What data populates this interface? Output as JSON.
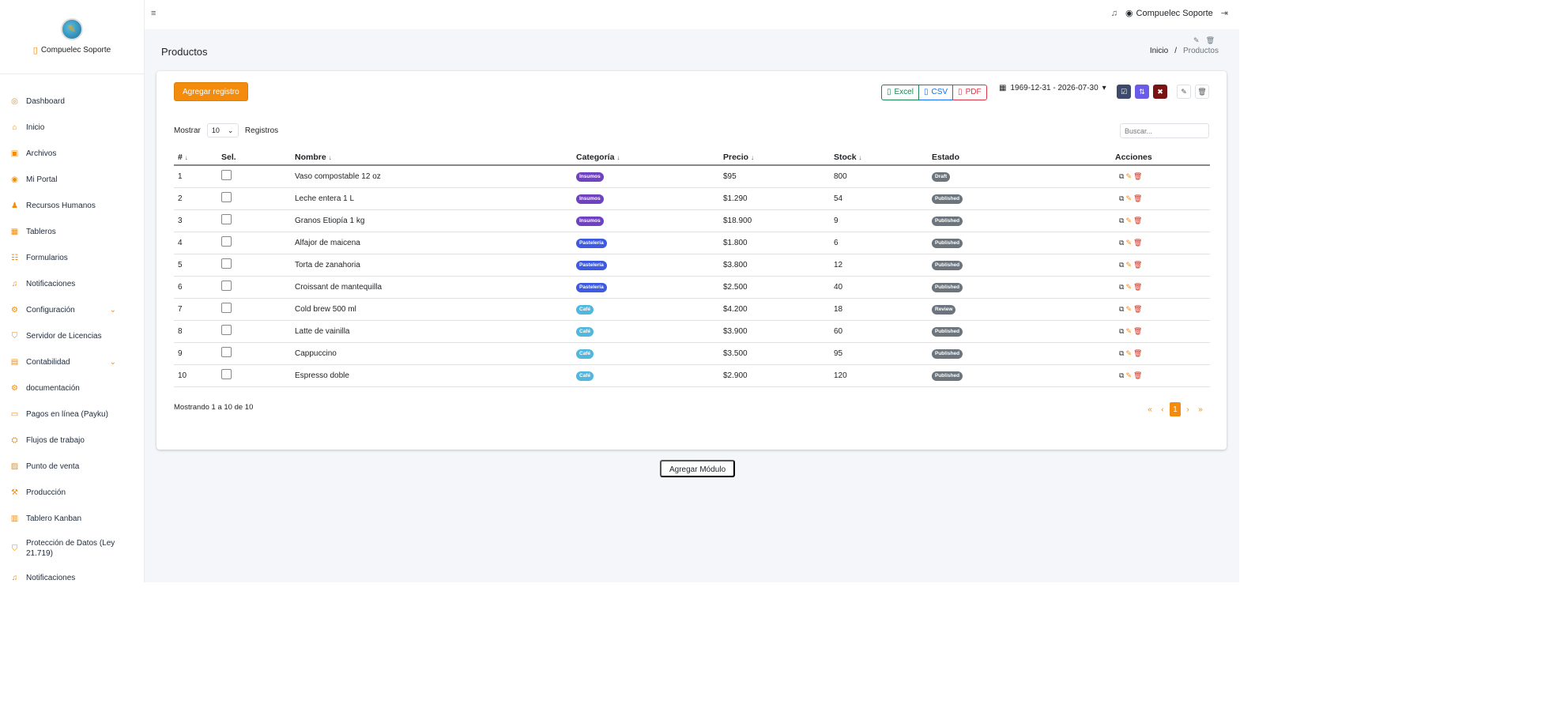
{
  "brand": {
    "name": "Compuelec Soporte"
  },
  "sidebar": {
    "items": [
      {
        "label": "Dashboard",
        "icon": "dashboard-icon",
        "glyph": "◎"
      },
      {
        "label": "Inicio",
        "icon": "home-icon",
        "glyph": "⌂"
      },
      {
        "label": "Archivos",
        "icon": "file-icon",
        "glyph": "▣"
      },
      {
        "label": "Mi Portal",
        "icon": "user-circle-icon",
        "glyph": "◉"
      },
      {
        "label": "Recursos Humanos",
        "icon": "users-icon",
        "glyph": "♟"
      },
      {
        "label": "Tableros",
        "icon": "grid-icon",
        "glyph": "▦"
      },
      {
        "label": "Formularios",
        "icon": "form-icon",
        "glyph": "☷"
      },
      {
        "label": "Notificaciones",
        "icon": "bell-icon",
        "glyph": "♫"
      },
      {
        "label": "Configuración",
        "icon": "gear-icon",
        "glyph": "⚙",
        "chevron": true
      },
      {
        "label": "Servidor de Licencias",
        "icon": "shield-icon",
        "glyph": "⛉"
      },
      {
        "label": "Contabilidad",
        "icon": "calculator-icon",
        "glyph": "▤",
        "chevron": true
      },
      {
        "label": "documentación",
        "icon": "gear-icon",
        "glyph": "⚙"
      },
      {
        "label": "Pagos en línea (Payku)",
        "icon": "card-icon",
        "glyph": "▭"
      },
      {
        "label": "Flujos de trabajo",
        "icon": "flow-icon",
        "glyph": "⛭"
      },
      {
        "label": "Punto de venta",
        "icon": "pos-icon",
        "glyph": "▨"
      },
      {
        "label": "Producción",
        "icon": "hammer-icon",
        "glyph": "⚒"
      },
      {
        "label": "Tablero Kanban",
        "icon": "kanban-icon",
        "glyph": "▥"
      },
      {
        "label": "Protección de Datos (Ley 21.719)",
        "icon": "shield-icon",
        "glyph": "⛉",
        "twoLine": true
      },
      {
        "label": "Notificaciones",
        "icon": "bell-icon",
        "glyph": "♫"
      }
    ]
  },
  "header": {
    "menu_glyph": "≡",
    "user_name": "Compuelec Soporte"
  },
  "page": {
    "title": "Productos",
    "breadcrumb": [
      "Inicio",
      "/",
      "Productos"
    ]
  },
  "toolbar": {
    "add_label": "Agregar registro",
    "excel_label": "Excel",
    "csv_label": "CSV",
    "pdf_label": "PDF",
    "date_range": "1969-12-31 - 2026-07-30"
  },
  "table_controls": {
    "show_label": "Mostrar",
    "page_size": "10",
    "records_label": "Registros",
    "search_placeholder": "Buscar..."
  },
  "table": {
    "headers": [
      "#",
      "Sel.",
      "Nombre",
      "Categoría",
      "Precio",
      "Stock",
      "Estado",
      "Acciones"
    ],
    "rows": [
      {
        "n": "1",
        "name": "Vaso compostable 12 oz",
        "cat": "Insumos",
        "price": "$95",
        "stock": "800",
        "status": "Draft"
      },
      {
        "n": "2",
        "name": "Leche entera 1 L",
        "cat": "Insumos",
        "price": "$1.290",
        "stock": "54",
        "status": "Published"
      },
      {
        "n": "3",
        "name": "Granos Etiopía 1 kg",
        "cat": "Insumos",
        "price": "$18.900",
        "stock": "9",
        "status": "Published"
      },
      {
        "n": "4",
        "name": "Alfajor de maicena",
        "cat": "Pastelería",
        "price": "$1.800",
        "stock": "6",
        "status": "Published"
      },
      {
        "n": "5",
        "name": "Torta de zanahoria",
        "cat": "Pastelería",
        "price": "$3.800",
        "stock": "12",
        "status": "Published"
      },
      {
        "n": "6",
        "name": "Croissant de mantequilla",
        "cat": "Pastelería",
        "price": "$2.500",
        "stock": "40",
        "status": "Published"
      },
      {
        "n": "7",
        "name": "Cold brew 500 ml",
        "cat": "Café",
        "price": "$4.200",
        "stock": "18",
        "status": "Review"
      },
      {
        "n": "8",
        "name": "Latte de vainilla",
        "cat": "Café",
        "price": "$3.900",
        "stock": "60",
        "status": "Published"
      },
      {
        "n": "9",
        "name": "Cappuccino",
        "cat": "Café",
        "price": "$3.500",
        "stock": "95",
        "status": "Published"
      },
      {
        "n": "10",
        "name": "Espresso doble",
        "cat": "Café",
        "price": "$2.900",
        "stock": "120",
        "status": "Published"
      }
    ]
  },
  "badge_colors": {
    "Insumos": "#6f42c1",
    "Pastelería": "#3d5ae0",
    "Café": "#4fb7e0",
    "Draft": "#6c757d",
    "Published": "#6c757d",
    "Review": "#6c757d"
  },
  "footer": {
    "info": "Mostrando 1 a 10 de 10",
    "pager": [
      "«",
      "‹",
      "1",
      "›",
      "»"
    ],
    "current_page": "1"
  },
  "add_module_label": "Agregar Módulo",
  "accent_color": "#f38b0c"
}
